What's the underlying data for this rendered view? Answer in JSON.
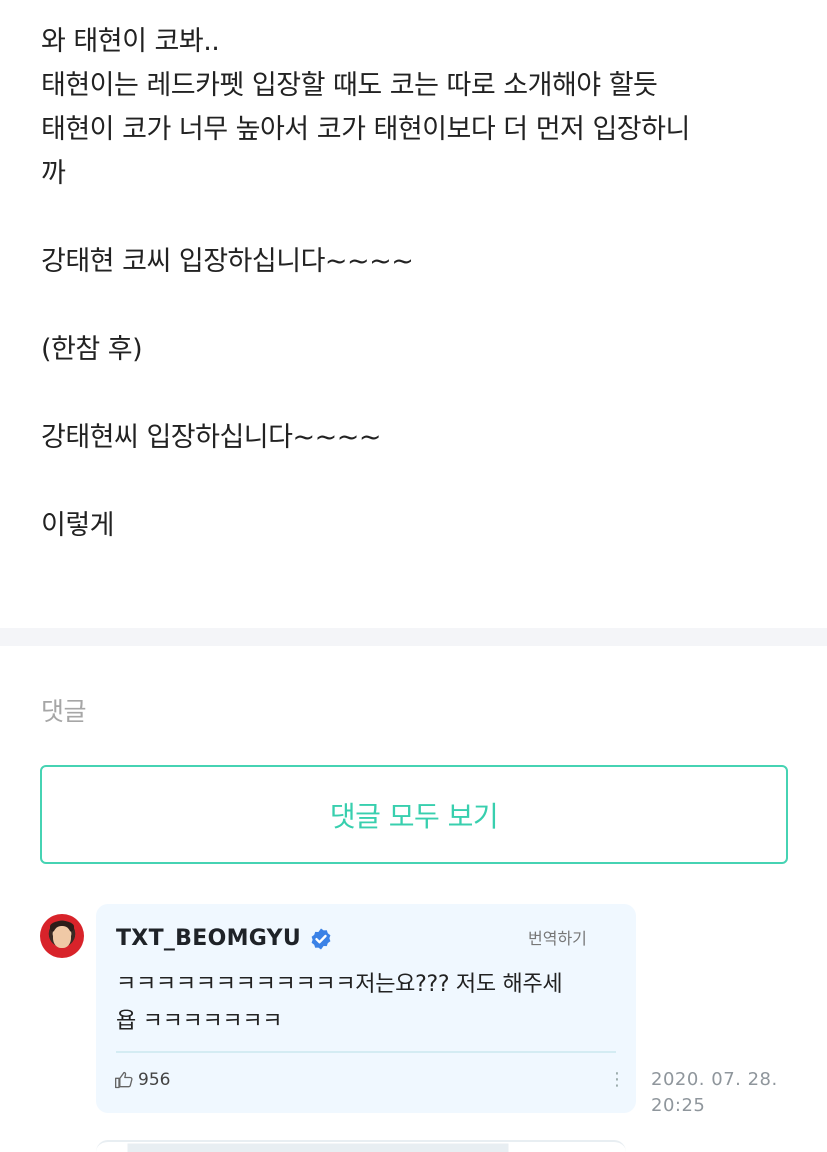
{
  "post": {
    "lines": [
      "와 태현이 코봐..",
      "태현이는 레드카펫 입장할 때도 코는 따로 소개해야 할듯",
      "태현이 코가 너무 높아서 코가 태현이보다 더 먼저 입장하니",
      "까",
      "",
      "강태현 코씨 입장하십니다~~~~",
      "",
      "(한참 후)",
      "",
      "강태현씨 입장하십니다~~~~",
      "",
      "이렇게"
    ]
  },
  "comments": {
    "section_title": "댓글",
    "view_all_label": "댓글 모두 보기",
    "items": [
      {
        "author": "TXT_BEOMGYU",
        "verified": true,
        "translate_label": "번역하기",
        "text_lines": [
          "ㅋㅋㅋㅋㅋㅋㅋㅋㅋㅋㅋㅋ저는요??? 저도 해주세",
          "욥 ㅋㅋㅋㅋㅋㅋㅋ"
        ],
        "likes": "956",
        "more_icon": "⋮",
        "date": "2020. 07. 28.",
        "time": "20:25"
      }
    ]
  },
  "colors": {
    "accent": "#38cfae",
    "bubble_bg": "#f0f8ff",
    "verified_badge": "#3b82e6"
  }
}
